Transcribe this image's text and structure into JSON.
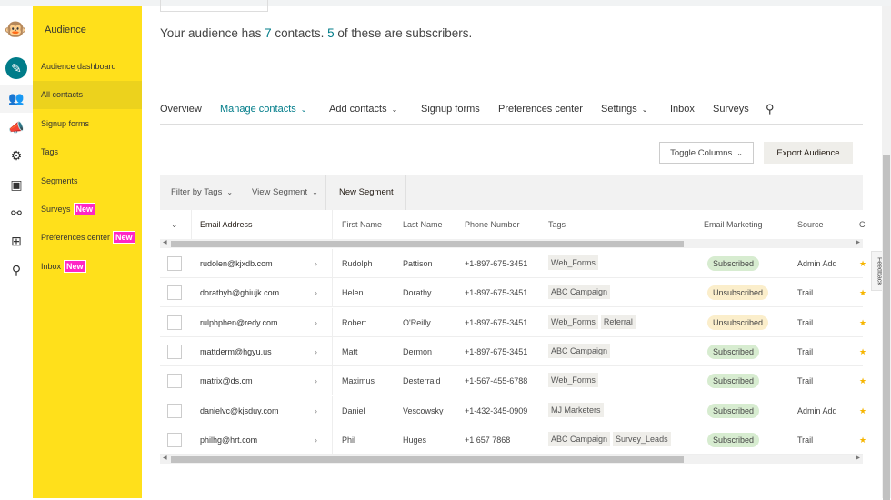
{
  "rail": {
    "icons": [
      "mailchimp-logo-icon",
      "create-pencil-icon",
      "audience-icon",
      "campaigns-megaphone-icon",
      "automations-icon",
      "website-icon",
      "integrations-icon",
      "apps-grid-icon",
      "search-icon"
    ]
  },
  "sidebar": {
    "title": "Audience",
    "items": [
      {
        "label": "Audience dashboard"
      },
      {
        "label": "All contacts",
        "active": true
      },
      {
        "label": "Signup forms"
      },
      {
        "label": "Tags"
      },
      {
        "label": "Segments"
      },
      {
        "label": "Surveys",
        "badge": "New"
      },
      {
        "label": "Preferences center",
        "badge": "New"
      },
      {
        "label": "Inbox",
        "badge": "New"
      }
    ]
  },
  "summary": {
    "pre": "Your audience has ",
    "contacts": "7",
    "mid": " contacts. ",
    "subscribers": "5",
    "post": " of these are subscribers."
  },
  "nav": {
    "items": [
      {
        "label": "Overview"
      },
      {
        "label": "Manage contacts",
        "dropdown": true,
        "active": true
      },
      {
        "label": "Add contacts",
        "dropdown": true
      },
      {
        "label": "Signup forms"
      },
      {
        "label": "Preferences center"
      },
      {
        "label": "Settings",
        "dropdown": true
      },
      {
        "label": "Inbox"
      },
      {
        "label": "Surveys"
      }
    ]
  },
  "actions": {
    "toggle_columns": "Toggle Columns",
    "export": "Export Audience"
  },
  "toolbar": {
    "filter_tags": "Filter by Tags",
    "view_segment": "View Segment",
    "new_segment": "New Segment"
  },
  "table": {
    "headers": [
      "Email Address",
      "First Name",
      "Last Name",
      "Phone Number",
      "Tags",
      "Email Marketing",
      "Source",
      "C"
    ],
    "rows": [
      {
        "email": "rudolen@kjxdb.com",
        "first": "Rudolph",
        "last": "Pattison",
        "phone": "+1-897-675-3451",
        "tags": [
          "Web_Forms"
        ],
        "status": "Subscribed",
        "source": "Admin Add"
      },
      {
        "email": "dorathyh@ghiujk.com",
        "first": "Helen",
        "last": "Dorathy",
        "phone": "+1-897-675-3451",
        "tags": [
          "ABC Campaign"
        ],
        "status": "Unsubscribed",
        "source": "Trail"
      },
      {
        "email": "rulphphen@redy.com",
        "first": "Robert",
        "last": "O'Reilly",
        "phone": "+1-897-675-3451",
        "tags": [
          "Web_Forms",
          "Referral"
        ],
        "status": "Unsubscribed",
        "source": "Trail"
      },
      {
        "email": "mattderm@hgyu.us",
        "first": "Matt",
        "last": "Dermon",
        "phone": "+1-897-675-3451",
        "tags": [
          "ABC Campaign"
        ],
        "status": "Subscribed",
        "source": "Trail"
      },
      {
        "email": "matrix@ds.cm",
        "first": "Maximus",
        "last": "Desterraid",
        "phone": "+1-567-455-6788",
        "tags": [
          "Web_Forms"
        ],
        "status": "Subscribed",
        "source": "Trail"
      },
      {
        "email": "danielvc@kjsduy.com",
        "first": "Daniel",
        "last": "Vescowsky",
        "phone": "+1-432-345-0909",
        "tags": [
          "MJ Marketers"
        ],
        "status": "Subscribed",
        "source": "Admin Add"
      },
      {
        "email": "philhg@hrt.com",
        "first": "Phil",
        "last": "Huges",
        "phone": "+1 657 7868",
        "tags": [
          "ABC Campaign",
          "Survey_Leads"
        ],
        "status": "Subscribed",
        "source": "Trail"
      }
    ]
  },
  "feedback": "Feedback",
  "colors": {
    "sidebar": "#ffe01b",
    "accent": "#007c89",
    "new_badge": "#ff26c6",
    "subscribed": "#d7ecd0",
    "unsubscribed": "#fbeecb"
  }
}
